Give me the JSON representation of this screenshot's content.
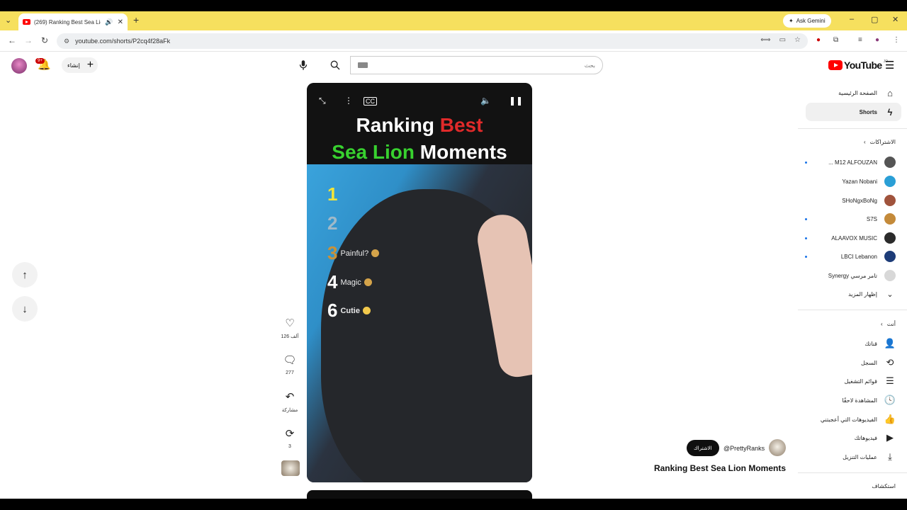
{
  "browser": {
    "tab_title": "(269) Ranking Best Sea Lion",
    "url": "youtube.com/shorts/P2cq4f28aFk",
    "ask_gemini": "Ask Gemini"
  },
  "header": {
    "notif_badge": "9+",
    "create_label": "إنشاء",
    "search_placeholder": "بحث",
    "logo_text": "YouTube",
    "logo_country": "JO"
  },
  "video": {
    "title_line1_a": "Ranking ",
    "title_line1_b": "Best",
    "title_line2_a": "Sea Lion",
    "title_line2_b": " Moments",
    "ranks": [
      {
        "num": "1",
        "label": ""
      },
      {
        "num": "2",
        "label": ""
      },
      {
        "num": "3",
        "label": "Painful?"
      },
      {
        "num": "4",
        "label": "Magic"
      },
      {
        "num": "6",
        "label": "Cutie"
      }
    ]
  },
  "actions": {
    "likes": "126 ألف",
    "comments": "277",
    "share": "مشاركة",
    "remix": "3"
  },
  "channel": {
    "subscribe": "الاشتراك",
    "handle": "@PrettyRanks",
    "video_title": "Ranking Best Sea Lion Moments"
  },
  "sidebar": {
    "home": "الصفحة الرئيسية",
    "shorts": "Shorts",
    "subscriptions": "الاشتراكات",
    "channels": [
      {
        "name": "M12 ALFOUZAN ...",
        "color": "#555555",
        "dot": "#1a73e8"
      },
      {
        "name": "Yazan Nobani",
        "color": "#2a9fd6",
        "dot": ""
      },
      {
        "name": "SHoNgxBoNg",
        "color": "#a0533c",
        "dot": ""
      },
      {
        "name": "S7S",
        "color": "#c48a3a",
        "dot": "#1a73e8"
      },
      {
        "name": "ALAAVOX MUSIC",
        "color": "#2b2b2b",
        "dot": "#1a73e8"
      },
      {
        "name": "LBCI Lebanon",
        "color": "#1d3c78",
        "dot": "#1a73e8"
      },
      {
        "name": "تامر مرسي Synergy",
        "color": "#d8d8d8",
        "dot": ""
      }
    ],
    "show_more": "إظهار المزيد",
    "you": "أنت",
    "you_items": [
      "قناتك",
      "السجل",
      "قوائم التشغيل",
      "المشاهدة لاحقًا",
      "الفيديوهات التي أعجبتني",
      "فيديوهاتك",
      "عمليات التنزيل"
    ],
    "explore": "استكشاف"
  }
}
